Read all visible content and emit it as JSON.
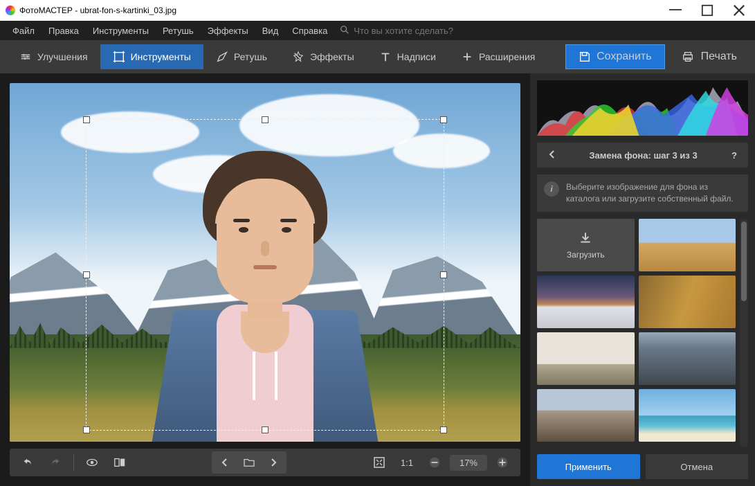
{
  "titlebar": {
    "app": "ФотоМАСТЕР",
    "file": "ubrat-fon-s-kartinki_03.jpg"
  },
  "menubar": {
    "items": [
      "Файл",
      "Правка",
      "Инструменты",
      "Ретушь",
      "Эффекты",
      "Вид",
      "Справка"
    ],
    "search_placeholder": "Что вы хотите сделать?"
  },
  "toolbar": {
    "tabs": [
      {
        "label": "Улучшения"
      },
      {
        "label": "Инструменты",
        "active": true
      },
      {
        "label": "Ретушь"
      },
      {
        "label": "Эффекты"
      },
      {
        "label": "Надписи"
      },
      {
        "label": "Расширения"
      }
    ],
    "save_label": "Сохранить",
    "print_label": "Печать"
  },
  "canvas_bar": {
    "ratio_label": "1:1",
    "zoom": "17%"
  },
  "panel": {
    "step_title": "Замена фона: шаг 3 из 3",
    "info_text": "Выберите изображение для фона из каталога или загрузите собственный файл.",
    "upload_label": "Загрузить",
    "apply_label": "Применить",
    "cancel_label": "Отмена"
  }
}
